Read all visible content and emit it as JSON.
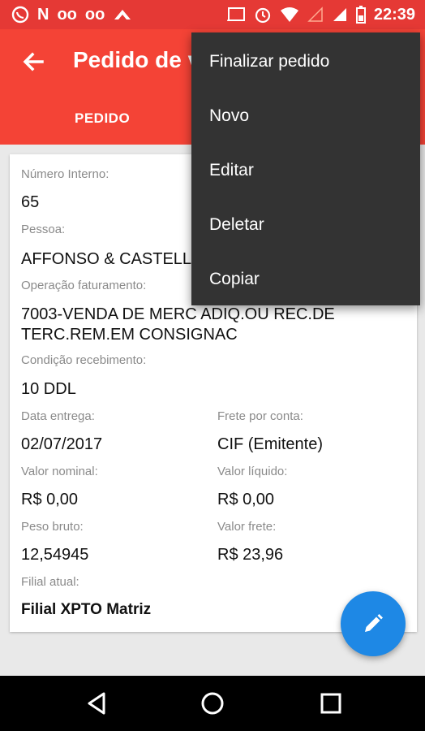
{
  "status_bar": {
    "left_icons": [
      "whatsapp-icon",
      "n-app-icon",
      "voicemail-icon",
      "voicemail-icon",
      "cloud-icon"
    ],
    "right_icons": [
      "cast-icon",
      "alarm-icon",
      "wifi-icon",
      "signal-empty-icon",
      "signal-icon",
      "battery-icon"
    ],
    "time": "22:39"
  },
  "app_bar": {
    "title": "Pedido de v",
    "tab": "PEDIDO",
    "color": "#f44336"
  },
  "fields": {
    "numero_interno": {
      "label": "Número Interno:",
      "value": "65"
    },
    "pessoa": {
      "label": "Pessoa:",
      "value": "AFFONSO & CASTELL"
    },
    "operacao": {
      "label": "Operação faturamento:",
      "line1": "7003-VENDA DE MERC ADIQ.OU REC.DE",
      "line2": "TERC.REM.EM CONSIGNAC"
    },
    "condicao": {
      "label": "Condição recebimento:",
      "value": "10 DDL"
    },
    "data_entrega": {
      "label": "Data entrega:",
      "value": "02/07/2017"
    },
    "frete_conta": {
      "label": "Frete por conta:",
      "value": "CIF (Emitente)"
    },
    "valor_nominal": {
      "label": "Valor nominal:",
      "value": "R$ 0,00"
    },
    "valor_liquido": {
      "label": "Valor líquido:",
      "value": "R$ 0,00"
    },
    "peso_bruto": {
      "label": "Peso bruto:",
      "value": "12,54945"
    },
    "valor_frete": {
      "label": "Valor frete:",
      "value": "R$ 23,96"
    },
    "filial": {
      "label": "Filial atual:",
      "value": "Filial XPTO Matriz"
    }
  },
  "menu": {
    "items": [
      "Finalizar pedido",
      "Novo",
      "Editar",
      "Deletar",
      "Copiar"
    ]
  },
  "fab": {
    "icon": "pencil-icon",
    "color": "#1e88e5"
  },
  "nav": {
    "icons": [
      "back-triangle-icon",
      "home-circle-icon",
      "recents-square-icon"
    ]
  }
}
